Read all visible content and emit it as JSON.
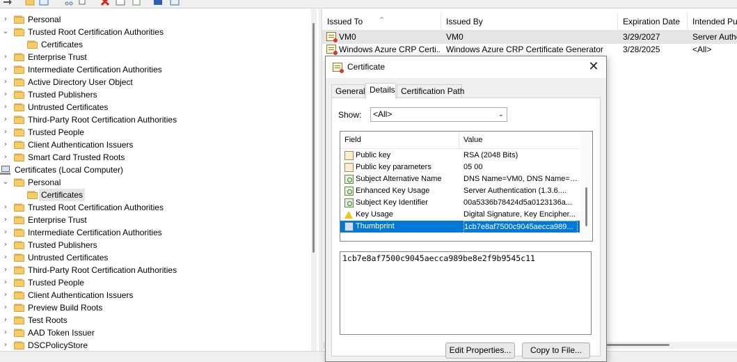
{
  "tree": {
    "items": [
      {
        "label": "Personal",
        "expanded": false,
        "level": 1
      },
      {
        "label": "Trusted Root Certification Authorities",
        "expanded": true,
        "level": 1
      },
      {
        "label": "Certificates",
        "level": 2
      },
      {
        "label": "Enterprise Trust",
        "expanded": false,
        "level": 1
      },
      {
        "label": "Intermediate Certification Authorities",
        "expanded": false,
        "level": 1
      },
      {
        "label": "Active Directory User Object",
        "expanded": false,
        "level": 1
      },
      {
        "label": "Trusted Publishers",
        "expanded": false,
        "level": 1
      },
      {
        "label": "Untrusted Certificates",
        "expanded": false,
        "level": 1
      },
      {
        "label": "Third-Party Root Certification Authorities",
        "expanded": false,
        "level": 1
      },
      {
        "label": "Trusted People",
        "expanded": false,
        "level": 1
      },
      {
        "label": "Client Authentication Issuers",
        "expanded": false,
        "level": 1
      },
      {
        "label": "Smart Card Trusted Roots",
        "expanded": false,
        "level": 1
      },
      {
        "label": "Certificates (Local Computer)",
        "level": 0
      },
      {
        "label": "Personal",
        "expanded": true,
        "level": 1
      },
      {
        "label": "Certificates",
        "level": 2,
        "selected": true
      },
      {
        "label": "Trusted Root Certification Authorities",
        "expanded": false,
        "level": 1
      },
      {
        "label": "Enterprise Trust",
        "expanded": false,
        "level": 1
      },
      {
        "label": "Intermediate Certification Authorities",
        "expanded": false,
        "level": 1
      },
      {
        "label": "Trusted Publishers",
        "expanded": false,
        "level": 1
      },
      {
        "label": "Untrusted Certificates",
        "expanded": false,
        "level": 1
      },
      {
        "label": "Third-Party Root Certification Authorities",
        "expanded": false,
        "level": 1
      },
      {
        "label": "Trusted People",
        "expanded": false,
        "level": 1
      },
      {
        "label": "Client Authentication Issuers",
        "expanded": false,
        "level": 1
      },
      {
        "label": "Preview Build Roots",
        "expanded": false,
        "level": 1
      },
      {
        "label": "Test Roots",
        "expanded": false,
        "level": 1
      },
      {
        "label": "AAD Token Issuer",
        "expanded": false,
        "level": 1
      },
      {
        "label": "DSCPolicyStore",
        "expanded": false,
        "level": 1
      }
    ]
  },
  "list": {
    "columns": [
      "Issued To",
      "Issued By",
      "Expiration Date",
      "Intended Pu"
    ],
    "rows": [
      {
        "issued_to": "VM0",
        "issued_by": "VM0",
        "expiration": "3/29/2027",
        "purpose": "Server Authe"
      },
      {
        "issued_to": "Windows Azure CRP Certi...",
        "issued_by": "Windows Azure CRP Certificate Generator",
        "expiration": "3/28/2025",
        "purpose": "<All>"
      }
    ]
  },
  "dialog": {
    "title": "Certificate",
    "close_glyph": "✕",
    "tabs": [
      "General",
      "Details",
      "Certification Path"
    ],
    "active_tab": "Details",
    "show_label": "Show:",
    "show_value": "<All>",
    "grid_headers": {
      "field": "Field",
      "value": "Value"
    },
    "fields": [
      {
        "field": "Public key",
        "value": "RSA (2048 Bits)",
        "icon": "doc"
      },
      {
        "field": "Public key parameters",
        "value": "05 00",
        "icon": "doc"
      },
      {
        "field": "Subject Alternative Name",
        "value": "DNS Name=VM0, DNS Name=l...",
        "icon": "ext"
      },
      {
        "field": "Enhanced Key Usage",
        "value": "Server Authentication (1.3.6....",
        "icon": "ext"
      },
      {
        "field": "Subject Key Identifier",
        "value": "00a5336b78424d5a0123136a...",
        "icon": "ext"
      },
      {
        "field": "Key Usage",
        "value": "Digital Signature, Key Encipher...",
        "icon": "warn"
      },
      {
        "field": "Thumbprint",
        "value": "1cb7e8af7500c9045aecca989...",
        "icon": "thumb",
        "selected": true
      }
    ],
    "detail_value": "1cb7e8af7500c9045aecca989be8e2f9b9545c11",
    "buttons": {
      "edit": "Edit Properties...",
      "copy": "Copy to File..."
    }
  },
  "colors": {
    "selection": "#0078d7",
    "folder": "#f4cc69"
  }
}
